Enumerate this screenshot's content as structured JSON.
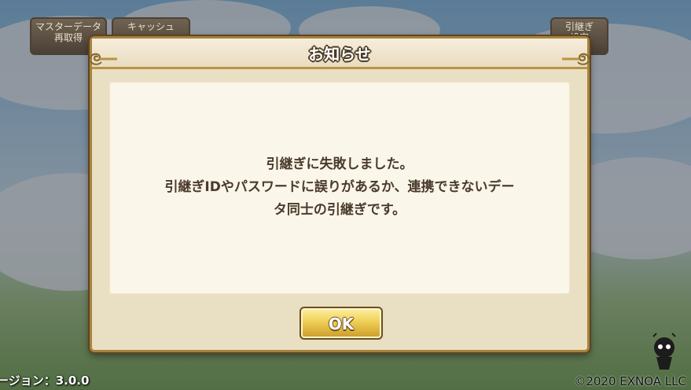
{
  "top_buttons": {
    "master_data": {
      "line1": "マスターデータ",
      "line2": "再取得"
    },
    "cache": {
      "label": "キャッシュ"
    },
    "transfer": {
      "line1": "引継ぎ",
      "line2": "設定"
    }
  },
  "dialog": {
    "title": "お知らせ",
    "message_lines": [
      "引継ぎに失敗しました。",
      "引継ぎIDやパスワードに誤りがあるか、連携できないデー",
      "タ同士の引継ぎです。"
    ],
    "ok_label": "OK"
  },
  "footer": {
    "version": "ージョン：3.0.0",
    "copyright": "©2020 EXNOA LLC"
  },
  "colors": {
    "dialog_border": "#a8823c",
    "dialog_bg": "#e9dfc3",
    "panel_bg": "#fbf6ea",
    "message_text": "#4a3b2c",
    "ok_button_gold": "#f0cf55"
  }
}
